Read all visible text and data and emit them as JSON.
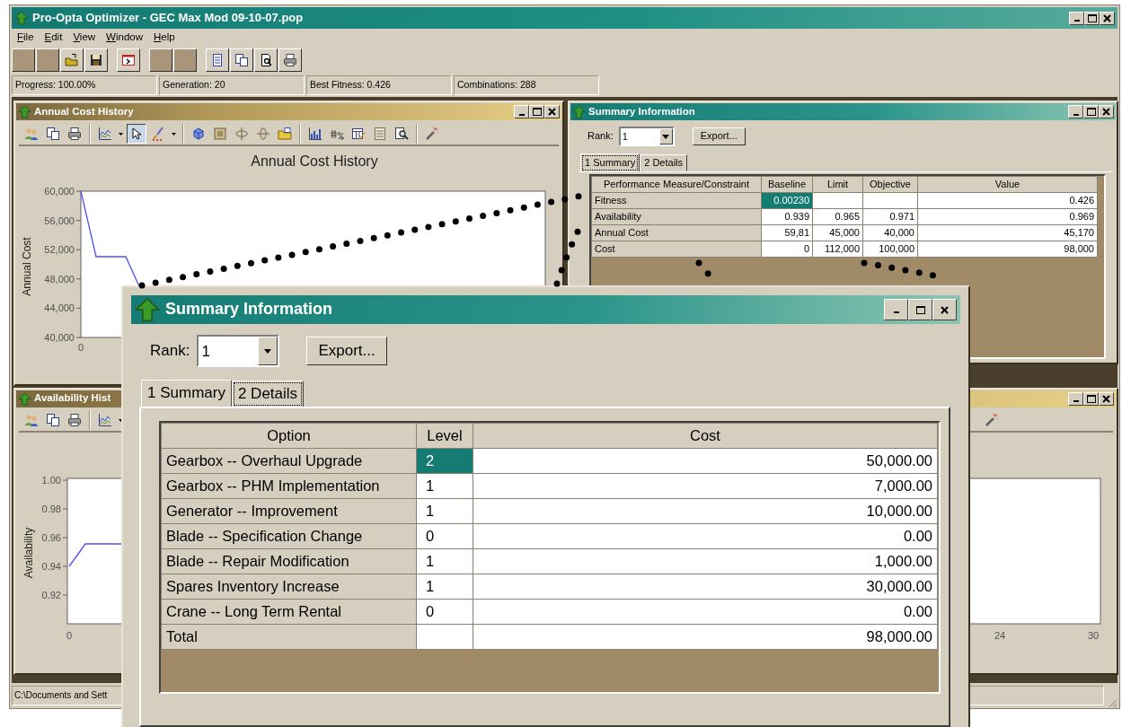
{
  "window": {
    "title": "Pro-Opta Optimizer - GEC Max Mod 09-10-07.pop"
  },
  "menu": [
    "File",
    "Edit",
    "View",
    "Window",
    "Help"
  ],
  "toolbar": [
    {
      "kind": "blank"
    },
    {
      "kind": "blank"
    },
    {
      "kind": "open"
    },
    {
      "kind": "save"
    },
    {
      "kind": "sep"
    },
    {
      "kind": "terminal"
    },
    {
      "kind": "sep"
    },
    {
      "kind": "blank"
    },
    {
      "kind": "blank"
    },
    {
      "kind": "sep"
    },
    {
      "kind": "document"
    },
    {
      "kind": "copy"
    },
    {
      "kind": "preview"
    },
    {
      "kind": "print"
    }
  ],
  "progress_panels": [
    "Progress: 100.00%",
    "Generation: 20",
    "Best Fitness: 0.426",
    "Combinations: 288"
  ],
  "cost_history": {
    "title": "Annual Cost History",
    "toolbar": [
      {
        "kind": "users",
        "pressed": false
      },
      {
        "kind": "copy",
        "pressed": false
      },
      {
        "kind": "print",
        "pressed": false
      },
      {
        "kind": "sep"
      },
      {
        "kind": "linechart",
        "pressed": false
      },
      {
        "kind": "caret",
        "pressed": false
      },
      {
        "kind": "pointer",
        "pressed": true
      },
      {
        "kind": "brush",
        "pressed": false
      },
      {
        "kind": "caret",
        "pressed": false
      },
      {
        "kind": "sep"
      },
      {
        "kind": "cube",
        "pressed": false
      },
      {
        "kind": "frame",
        "pressed": false
      },
      {
        "kind": "rotateh",
        "pressed": false
      },
      {
        "kind": "rotatev",
        "pressed": false
      },
      {
        "kind": "folder",
        "pressed": false
      },
      {
        "kind": "sep"
      },
      {
        "kind": "barchart",
        "pressed": false
      },
      {
        "kind": "numfmt",
        "pressed": false
      },
      {
        "kind": "tableedit",
        "pressed": false
      },
      {
        "kind": "list",
        "pressed": false
      },
      {
        "kind": "zoom",
        "pressed": false
      },
      {
        "kind": "sep"
      },
      {
        "kind": "wand",
        "pressed": false
      }
    ],
    "chart": {
      "title": "Annual Cost History",
      "ylabel": "Annual Cost",
      "y_ticks": [
        "60,000",
        "56,000",
        "52,000",
        "48,000",
        "44,000",
        "40,000"
      ],
      "x_ticks": [
        "0"
      ]
    }
  },
  "summary_window": {
    "title": "Summary Information",
    "rank_label": "Rank:",
    "rank": "1",
    "export": "Export...",
    "tabs": [
      {
        "label": "1 Summary",
        "selected": true
      },
      {
        "label": "2 Details",
        "selected": false
      }
    ],
    "table": {
      "columns": [
        "Performance Measure/Constraint",
        "Baseline",
        "Limit",
        "Objective",
        "Value"
      ],
      "rows": [
        {
          "cells": [
            {
              "text": "Fitness",
              "selected": false
            },
            {
              "text": "0.00230",
              "selected": true
            },
            {
              "selected": false
            },
            {
              "selected": false
            },
            {
              "text": "0.426",
              "selected": false
            }
          ]
        },
        {
          "cells": [
            {
              "text": "Availability",
              "selected": false
            },
            {
              "text": "0.939",
              "selected": false
            },
            {
              "text": "0.965",
              "selected": false
            },
            {
              "text": "0.971",
              "selected": false
            },
            {
              "text": "0.969",
              "selected": false
            }
          ]
        },
        {
          "cells": [
            {
              "text": "Annual Cost",
              "selected": false
            },
            {
              "text": "59,81",
              "selected": false
            },
            {
              "text": "45,000",
              "selected": false
            },
            {
              "text": "40,000",
              "selected": false
            },
            {
              "text": "45,170",
              "selected": false
            }
          ]
        },
        {
          "cells": [
            {
              "text": "Cost",
              "selected": false
            },
            {
              "text": "0",
              "selected": false
            },
            {
              "text": "112,000",
              "selected": false
            },
            {
              "text": "100,000",
              "selected": false
            },
            {
              "text": "98,000",
              "selected": false
            }
          ]
        }
      ]
    }
  },
  "availability_history": {
    "title": "Availability Hist",
    "toolbar_left": [
      {
        "kind": "users",
        "pressed": false
      },
      {
        "kind": "copy",
        "pressed": false
      },
      {
        "kind": "print",
        "pressed": false
      },
      {
        "kind": "sep"
      },
      {
        "kind": "linechart",
        "pressed": false
      },
      {
        "kind": "caret",
        "pressed": false
      }
    ],
    "toolbar_right": [
      {
        "kind": "wand",
        "pressed": false
      }
    ],
    "chart": {
      "ylabel": "Availability",
      "y_ticks": [
        "1.00",
        "0.98",
        "0.96",
        "0.94",
        "0.92"
      ],
      "x_ticks": [
        "0",
        "24",
        "30"
      ]
    }
  },
  "details_window": {
    "title": "Summary Information",
    "rank_label": "Rank:",
    "rank": "1",
    "export": "Export...",
    "tabs": [
      {
        "label": "1 Summary",
        "selected": false
      },
      {
        "label": "2 Details",
        "selected": true
      }
    ],
    "table": {
      "columns": [
        "Option",
        "Level",
        "Cost"
      ],
      "rows": [
        {
          "option": "Gearbox -- Overhaul Upgrade",
          "level": "2",
          "cost": "50,000.00",
          "selected": true
        },
        {
          "option": "Gearbox -- PHM Implementation",
          "level": "1",
          "cost": "7,000.00",
          "selected": false
        },
        {
          "option": "Generator -- Improvement",
          "level": "1",
          "cost": "10,000.00",
          "selected": false
        },
        {
          "option": "Blade -- Specification Change",
          "level": "0",
          "cost": "0.00",
          "selected": false
        },
        {
          "option": "Blade -- Repair Modification",
          "level": "1",
          "cost": "1,000.00",
          "selected": false
        },
        {
          "option": "Spares Inventory Increase",
          "level": "1",
          "cost": "30,000.00",
          "selected": false
        },
        {
          "option": "Crane -- Long Term Rental",
          "level": "0",
          "cost": "0.00",
          "selected": false
        },
        {
          "option": "Total",
          "cost": "98,000.00",
          "selected": false
        }
      ]
    }
  },
  "status_bar": "C:\\Documents and Sett"
}
